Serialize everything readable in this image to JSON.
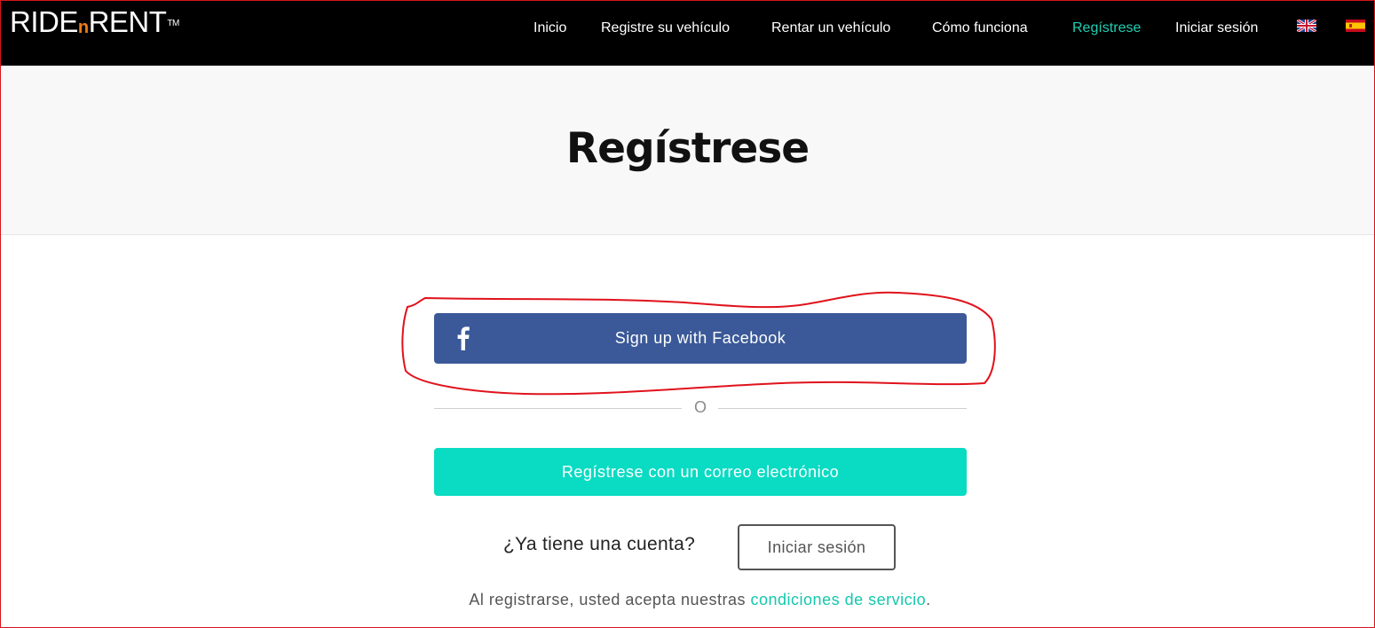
{
  "logo": {
    "main": "RIDE",
    "mid": "n",
    "tail": "RENT",
    "tm": "TM"
  },
  "nav": {
    "items": [
      {
        "label": "Inicio",
        "active": false
      },
      {
        "label": "Registre su vehículo",
        "active": false
      },
      {
        "label": "Rentar un vehículo",
        "active": false
      },
      {
        "label": "Cómo funciona",
        "active": false
      },
      {
        "label": "Regístrese",
        "active": true
      },
      {
        "label": "Iniciar sesión",
        "active": false
      }
    ],
    "languages": [
      "english-flag-icon",
      "spanish-flag-icon"
    ]
  },
  "hero": {
    "title": "Regístrese"
  },
  "facebook": {
    "label": "Sign up with Facebook",
    "icon": "facebook-icon",
    "color": "#3b5998"
  },
  "separator": {
    "text": "O"
  },
  "email_signup": {
    "label": "Regístrese con un correo electrónico",
    "color": "#0adbc3"
  },
  "account": {
    "question": "¿Ya tiene una cuenta?",
    "login_label": "Iniciar sesión"
  },
  "terms": {
    "prefix": "Al registrarse, usted acepta nuestras",
    "link": "condiciones de servicio",
    "suffix": "."
  },
  "colors": {
    "accent": "#20cfb2",
    "annotation": "#e0121b",
    "nav_bg": "#000000"
  }
}
